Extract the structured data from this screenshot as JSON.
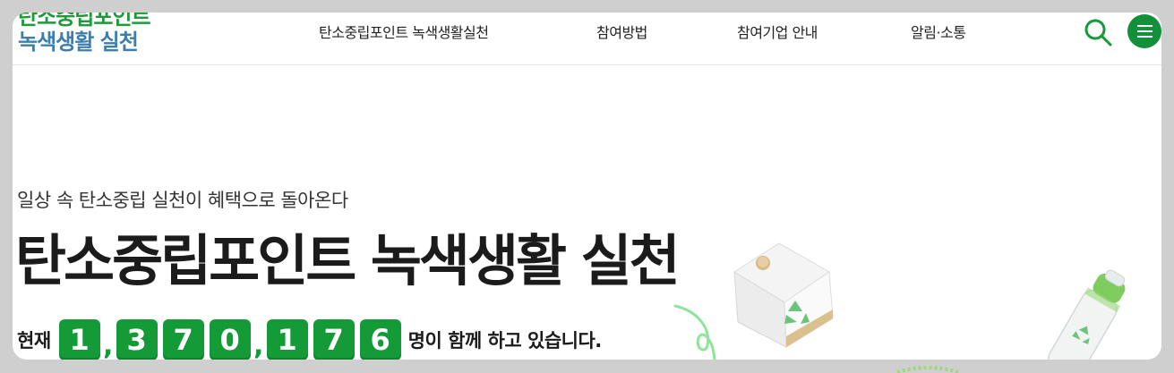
{
  "header": {
    "logo_line1": "탄소중립포인트",
    "logo_line2": "녹색생활 실천",
    "nav": [
      {
        "label": "탄소중립포인트 녹색생활실천"
      },
      {
        "label": "참여방법"
      },
      {
        "label": "참여기업 안내"
      },
      {
        "label": "알림·소통"
      }
    ],
    "search_icon": "search-icon",
    "menu_icon": "hamburger-menu-icon"
  },
  "hero": {
    "subtitle": "일상 속 탄소중립 실천이 혜택으로 돌아온다",
    "title": "탄소중립포인트 녹색생활 실천",
    "counter_prefix": "현재",
    "counter_digits": [
      "1",
      "3",
      "7",
      "0",
      "1",
      "7",
      "6"
    ],
    "counter_separator": ",",
    "counter_suffix": "명이 함께 하고 있습니다."
  },
  "colors": {
    "brand_green": "#149a37",
    "logo_blue": "#3b7fb0",
    "text_dark": "#1b1b1b"
  }
}
